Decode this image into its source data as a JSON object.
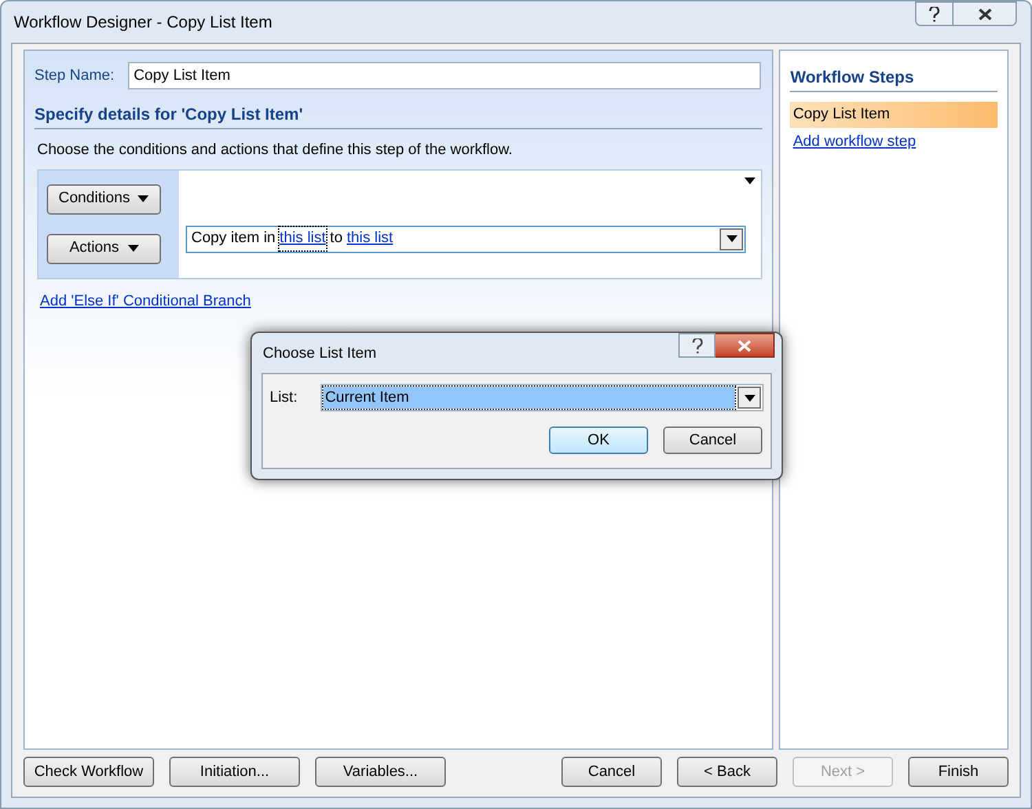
{
  "window": {
    "title": "Workflow Designer - Copy List Item"
  },
  "step_name": {
    "label": "Step Name:",
    "value": "Copy List Item"
  },
  "details": {
    "heading": "Specify details for 'Copy List Item'",
    "description": "Choose the conditions and actions that define this step of the workflow."
  },
  "rule": {
    "buttons": [
      "Conditions",
      "Actions"
    ],
    "action": [
      {
        "kind": "text",
        "text": "Copy item in"
      },
      {
        "kind": "link",
        "text": "this list",
        "focused": true
      },
      {
        "kind": "text",
        "text": "to"
      },
      {
        "kind": "link",
        "text": "this list",
        "focused": false
      }
    ]
  },
  "else_if_link": "Add 'Else If' Conditional Branch",
  "workflow_steps": {
    "title": "Workflow Steps",
    "items": [
      {
        "label": "Copy List Item",
        "selected": true
      }
    ],
    "add_link": "Add workflow step"
  },
  "footer_left_buttons": [
    {
      "label": "Check Workflow",
      "disabled": false
    },
    {
      "label": "Initiation...",
      "disabled": false
    },
    {
      "label": "Variables...",
      "disabled": false
    }
  ],
  "footer_right_buttons": [
    {
      "label": "Cancel",
      "disabled": false
    },
    {
      "label": "< Back",
      "disabled": false
    },
    {
      "label": "Next >",
      "disabled": true
    },
    {
      "label": "Finish",
      "disabled": false
    }
  ],
  "dialog": {
    "title": "Choose List Item",
    "field_label": "List:",
    "value": "Current Item",
    "buttons": [
      "OK",
      "Cancel"
    ]
  }
}
